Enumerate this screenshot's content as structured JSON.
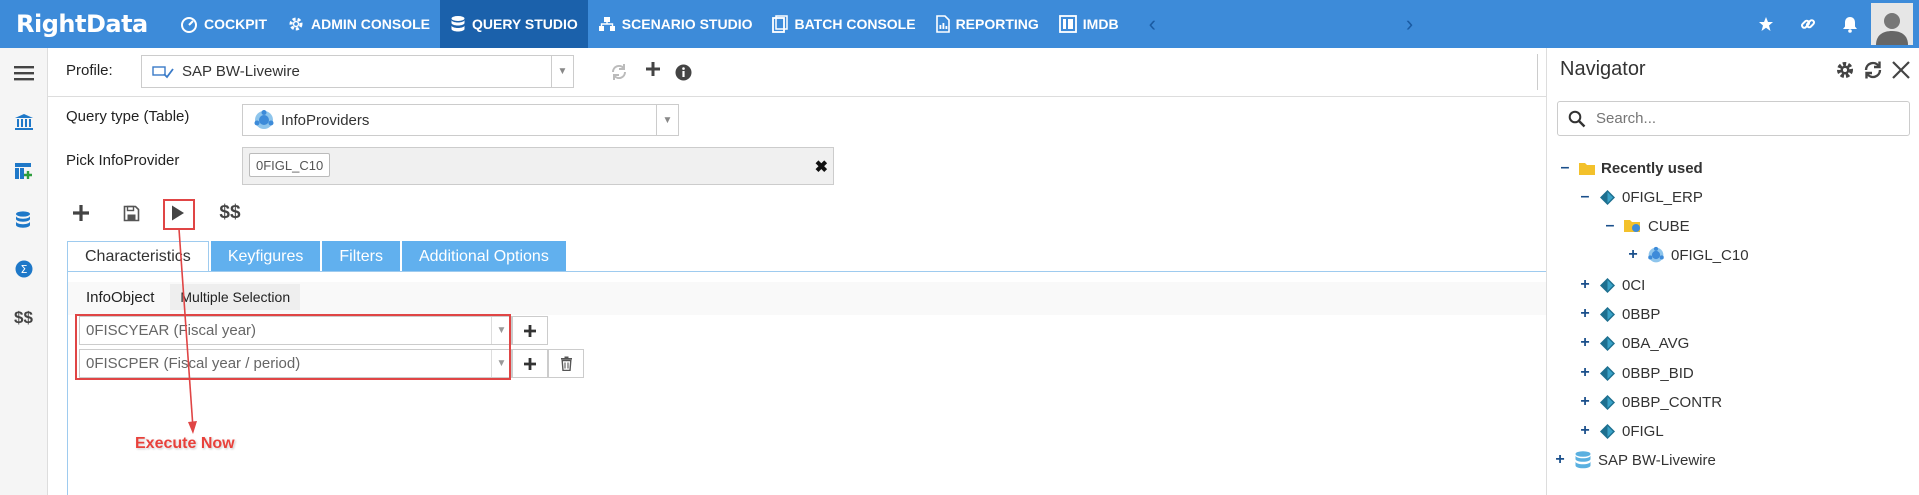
{
  "app": {
    "logo": "RightData"
  },
  "nav": {
    "items": [
      {
        "label": "COCKPIT",
        "icon": "cockpit-icon"
      },
      {
        "label": "ADMIN CONSOLE",
        "icon": "gear-icon"
      },
      {
        "label": "QUERY STUDIO",
        "icon": "database-icon",
        "active": true
      },
      {
        "label": "SCENARIO STUDIO",
        "icon": "scenario-icon"
      },
      {
        "label": "BATCH CONSOLE",
        "icon": "batch-icon"
      },
      {
        "label": "REPORTING",
        "icon": "report-icon"
      },
      {
        "label": "IMDB",
        "icon": "imdb-icon"
      }
    ],
    "prev_arrow": "‹",
    "next_arrow": "›"
  },
  "header_icons": [
    "star-icon",
    "link-icon",
    "bell-icon",
    "user-avatar"
  ],
  "sidebar": {
    "items": [
      "menu-icon",
      "bank-icon",
      "table-add-icon",
      "database-sync-icon",
      "globe-sigma-icon",
      "dollar-icon"
    ],
    "dollar_label": "$$"
  },
  "profile": {
    "label": "Profile:",
    "value": "SAP BW-Livewire"
  },
  "query": {
    "type_label": "Query type (Table)",
    "type_value": "InfoProviders",
    "pick_label": "Pick InfoProvider",
    "picked_tag": "0FIGL_C10",
    "toolbar_dollar": "$$"
  },
  "tabs": [
    {
      "label": "Characteristics",
      "active": true
    },
    {
      "label": "Keyfigures"
    },
    {
      "label": "Filters"
    },
    {
      "label": "Additional Options"
    }
  ],
  "subtabs": [
    {
      "label": "InfoObject"
    },
    {
      "label": "Multiple Selection"
    }
  ],
  "infoobjects": [
    {
      "value": "0FISCYEAR (Fiscal year)"
    },
    {
      "value": "0FISCPER (Fiscal year / period)"
    }
  ],
  "annotation": {
    "text": "Execute Now"
  },
  "navigator": {
    "title": "Navigator",
    "search_placeholder": "Search...",
    "tree": {
      "recent": "Recently used",
      "erp": "0FIGL_ERP",
      "cube": "CUBE",
      "c10": "0FIGL_C10",
      "items": [
        "0CI",
        "0BBP",
        "0BA_AVG",
        "0BBP_BID",
        "0BBP_CONTR",
        "0FIGL"
      ],
      "source": "SAP BW-Livewire"
    }
  },
  "colors": {
    "topbar": "#3d8bd9",
    "topbar_active": "#1b61ab",
    "tab_inactive": "#61b0ee",
    "annotation_red": "#e04545",
    "tree_blue": "#1a4f8b"
  }
}
